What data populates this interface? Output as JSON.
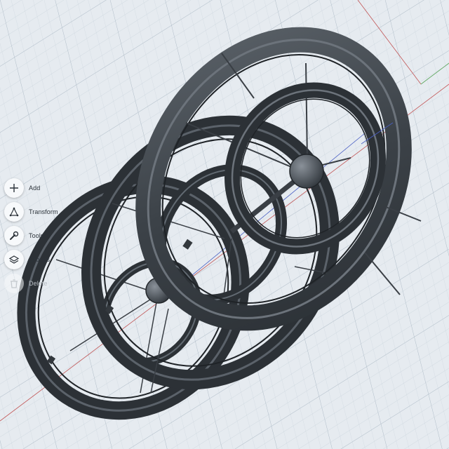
{
  "app": {
    "accent_color": "#3a3f45",
    "background_color": "#e6ebf0"
  },
  "toolbar": {
    "items": [
      {
        "label": "Add",
        "icon": "plus-icon",
        "enabled": true
      },
      {
        "label": "Transform",
        "icon": "transform-icon",
        "enabled": true
      },
      {
        "label": "Tools",
        "icon": "wrench-icon",
        "enabled": true
      },
      {
        "label": "Groups",
        "icon": "layers-icon",
        "enabled": true
      },
      {
        "label": "Delete",
        "icon": "trash-icon",
        "enabled": false
      }
    ]
  }
}
